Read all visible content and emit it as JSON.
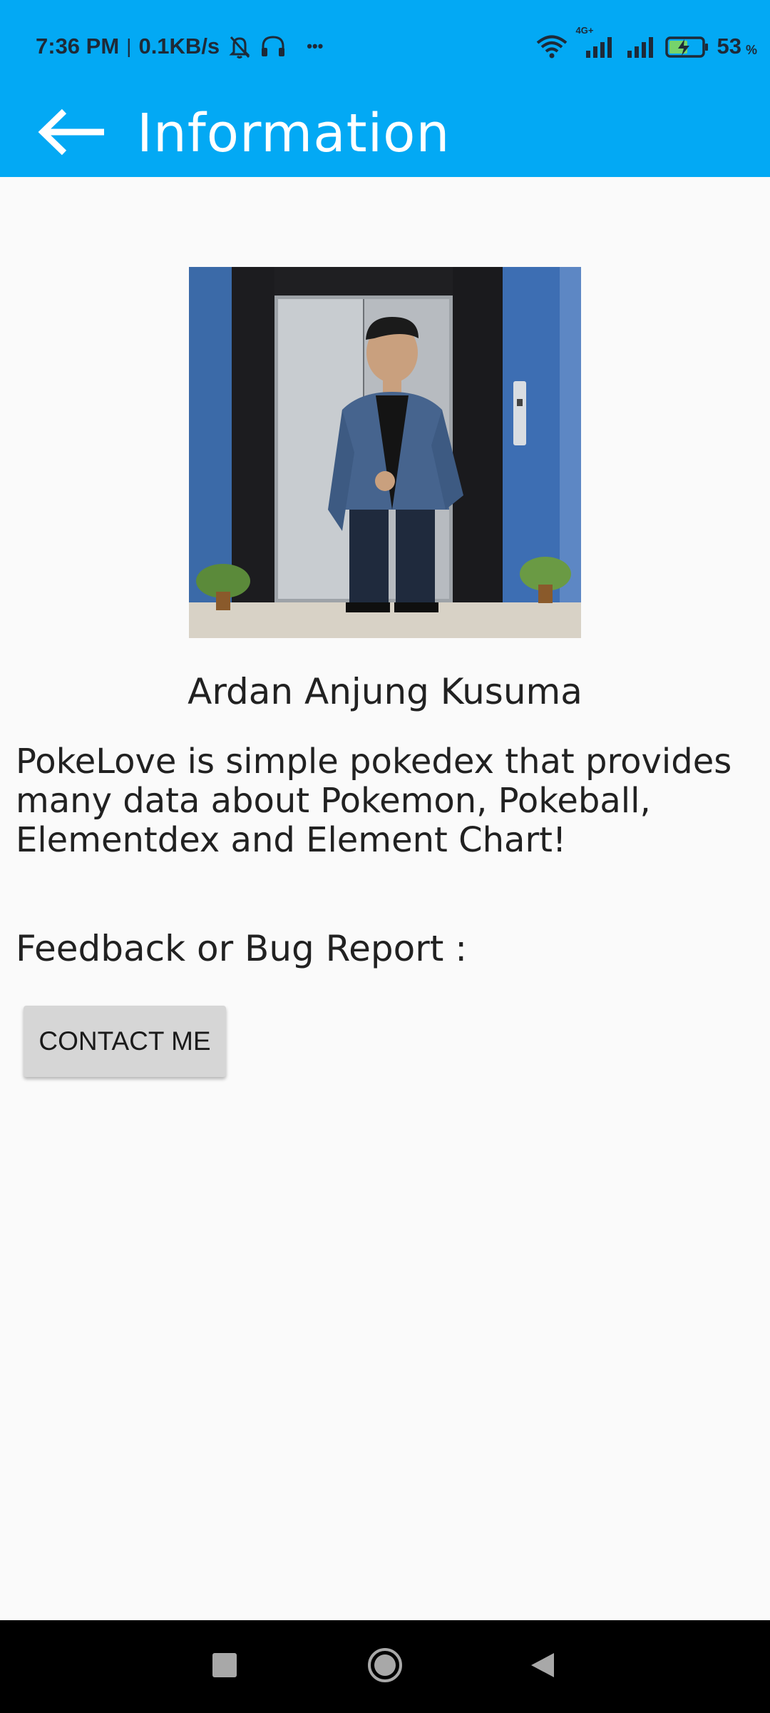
{
  "status_bar": {
    "time": "7:36 PM",
    "separator": "|",
    "speed": "0.1KB/s",
    "more": "•••",
    "network_badge": "4G+",
    "battery_level": "53",
    "battery_unit": "%",
    "icons": [
      "muted-bell-icon",
      "headset-icon",
      "wifi-icon",
      "cell-signal-icon",
      "battery-charging-icon"
    ]
  },
  "app_bar": {
    "title": "Information",
    "back_icon": "arrow-left-icon",
    "background_color": "#03a9f4"
  },
  "content": {
    "author_name": "Ardan Anjung Kusuma",
    "description": "PokeLove is simple pokedex that provides many data about Pokemon, Pokeball, Elementdex and Element Chart!",
    "feedback_label": "Feedback or Bug Report :",
    "contact_button_label": "CONTACT ME"
  },
  "nav_bar": {
    "icons": [
      "recents-square-icon",
      "home-circle-icon",
      "back-triangle-icon"
    ]
  }
}
